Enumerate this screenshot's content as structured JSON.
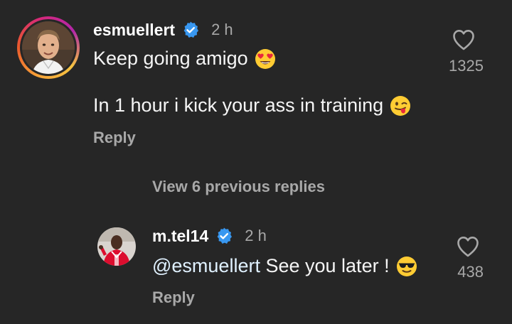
{
  "comments": [
    {
      "username": "esmuellert",
      "verified": true,
      "time": "2 h",
      "text_line1": "Keep going amigo",
      "text_line1_emoji": "heart-eyes-emoji",
      "text_line2": "In 1 hour i kick your ass in training",
      "text_line2_emoji": "winking-tongue-emoji",
      "reply_label": "Reply",
      "likes": "1325",
      "like_icon": "heart-outline-icon",
      "avatar_story_ring": true
    }
  ],
  "view_previous_label": "View 6 previous replies",
  "reply": {
    "username": "m.tel14",
    "verified": true,
    "time": "2 h",
    "mention": "@esmuellert",
    "text": " See you later !",
    "emoji": "sunglasses-emoji",
    "reply_label": "Reply",
    "likes": "438",
    "like_icon": "heart-outline-icon"
  },
  "colors": {
    "background": "#262626",
    "primary_text": "#f5f5f5",
    "secondary_text": "#a8a8a8",
    "verified_badge": "#3897f0"
  }
}
